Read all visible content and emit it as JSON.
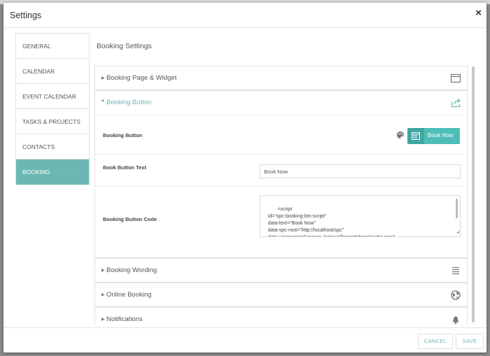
{
  "modal": {
    "title": "Settings",
    "close_glyph": "×"
  },
  "sidebar": {
    "items": [
      {
        "label": "GENERAL"
      },
      {
        "label": "CALENDAR"
      },
      {
        "label": "EVENT CALENDAR"
      },
      {
        "label": "TASKS & PROJECTS"
      },
      {
        "label": "CONTACTS"
      },
      {
        "label": "BOOKING",
        "active": true
      }
    ]
  },
  "main": {
    "section_title": "Booking Settings",
    "panels": [
      {
        "label": "Booking Page & Widget",
        "expanded": false,
        "icon": "window-icon"
      },
      {
        "label": "Booking Button",
        "expanded": true,
        "icon": "share-icon"
      },
      {
        "label": "Booking Wording",
        "expanded": false,
        "icon": "list-icon"
      },
      {
        "label": "Online Booking",
        "expanded": false,
        "icon": "globe-icon"
      },
      {
        "label": "Notifications",
        "expanded": false,
        "icon": "bell-icon"
      }
    ],
    "booking_button": {
      "row1_label": "Booking Button",
      "preview_label": "Book Now",
      "row2_label": "Book Button Text",
      "text_value": "Book Now",
      "row3_label": "Booking Button Code",
      "code": "<script\n   id=\"spc-booking-btn-script\"\n   data-text=\"Book Now\"\n   data-spc-root=\"http://localhost/spc\"\n   data-username=\"woman_haircut@smartphpcalendar.com\""
    }
  },
  "footer": {
    "cancel_label": "CANCEL",
    "save_label": "SAVE"
  },
  "colors": {
    "accent": "#6bb7b3",
    "button": "#4fbdb7"
  }
}
